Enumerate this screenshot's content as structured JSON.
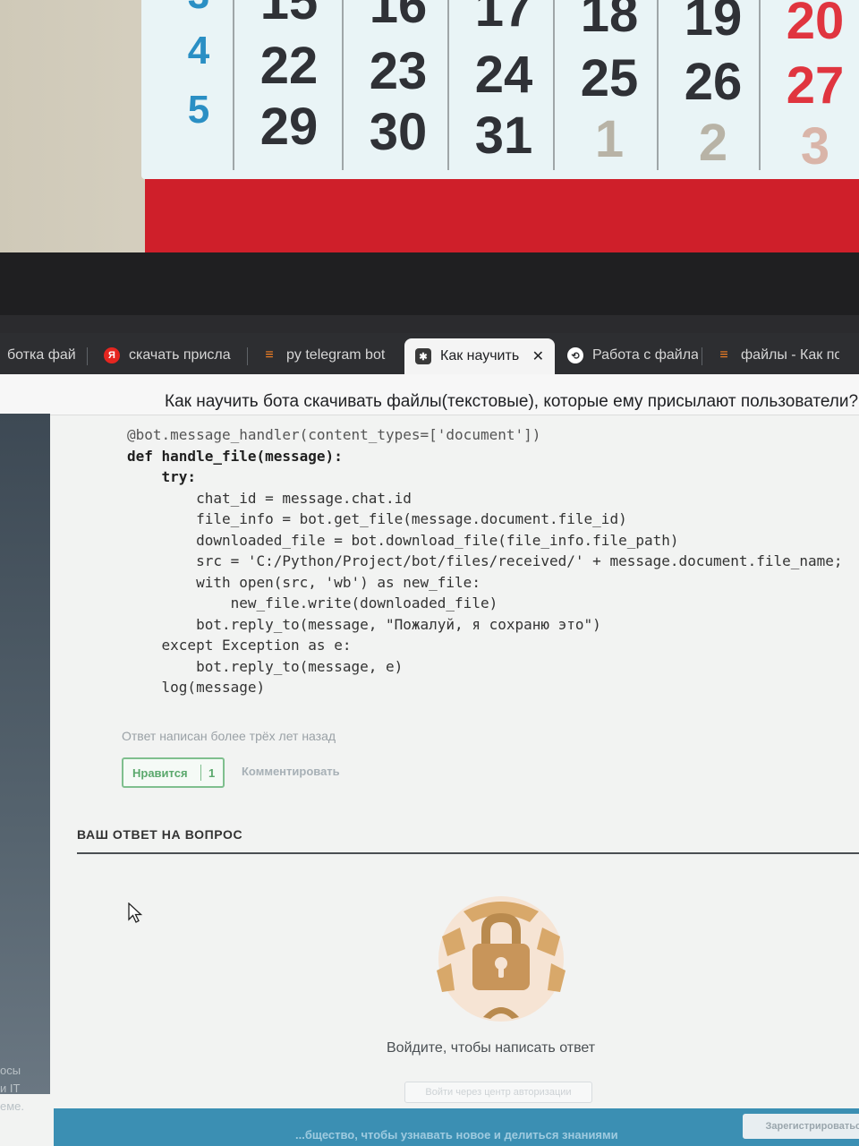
{
  "calendar": {
    "week_numbers": [
      "3",
      "4",
      "5"
    ],
    "rows": [
      [
        "15",
        "16",
        "17",
        "18",
        "19",
        "20"
      ],
      [
        "22",
        "23",
        "24",
        "25",
        "26",
        "27"
      ],
      [
        "29",
        "30",
        "31",
        "1",
        "2",
        "3"
      ]
    ]
  },
  "browser": {
    "tabs": [
      {
        "label": "ботка фай",
        "icon": "document-icon"
      },
      {
        "label": "скачать присла",
        "icon": "yandex-icon"
      },
      {
        "label": "py telegram bot",
        "icon": "stackoverflow-icon"
      },
      {
        "label": "Как научить б",
        "icon": "qna-icon",
        "active": true
      },
      {
        "label": "Работа с файла",
        "icon": "habr-icon"
      },
      {
        "label": "файлы - Как по",
        "icon": "stackoverflow-icon"
      }
    ],
    "close_glyph": "✕"
  },
  "question": {
    "title": "Как научить бота скачивать файлы(текстовые), которые ему присылают пользователи? —"
  },
  "code": {
    "lines": [
      "@bot.message_handler(content_types=['document'])",
      "def handle_file(message):",
      "    try:",
      "        chat_id = message.chat.id",
      "        file_info = bot.get_file(message.document.file_id)",
      "        downloaded_file = bot.download_file(file_info.file_path)",
      "        src = 'C:/Python/Project/bot/files/received/' + message.document.file_name;",
      "        with open(src, 'wb') as new_file:",
      "            new_file.write(downloaded_file)",
      "        bot.reply_to(message, \"Пожалуй, я сохраню это\")",
      "    except Exception as e:",
      "        bot.reply_to(message, e)",
      "    log(message)"
    ]
  },
  "answer": {
    "meta": "Ответ написан более трёх лет назад",
    "like_label": "Нравится",
    "like_count": "1",
    "comment_label": "Комментировать"
  },
  "your_answer": {
    "heading": "ВАШ ОТВЕТ НА ВОПРОС",
    "login_prompt": "Войдите, чтобы написать ответ",
    "login_button": "Войти через центр авторизации"
  },
  "left_rail": {
    "fragments": [
      "осы",
      "и IT",
      "еме."
    ]
  },
  "banner": {
    "text": "...бщество, чтобы узнавать новое и делиться знаниями",
    "register_button": "Зарегистрироваться"
  },
  "colors": {
    "accent_green": "#5aa86c",
    "calendar_blue": "#2a8fc4",
    "calendar_red": "#e0353f",
    "banner_blue": "#3b8fb3"
  }
}
